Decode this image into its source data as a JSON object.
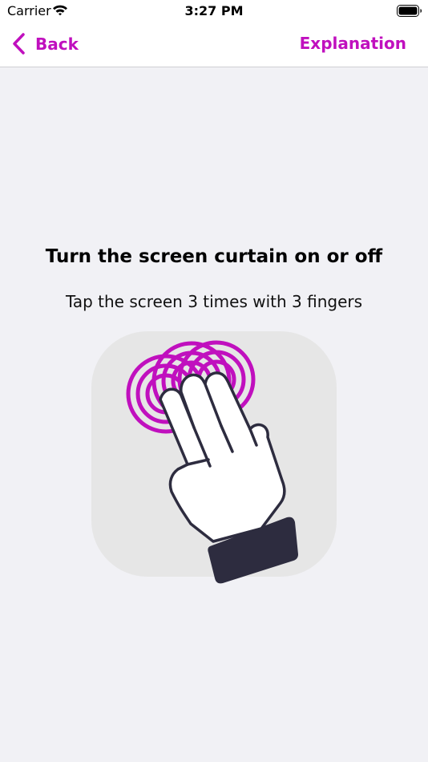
{
  "status_bar": {
    "carrier": "Carrier",
    "time": "3:27 PM",
    "wifi_icon": "wifi-icon",
    "battery_icon": "battery-icon"
  },
  "nav": {
    "back_label": "Back",
    "back_icon": "chevron-left-icon",
    "explanation_label": "Explanation"
  },
  "content": {
    "title": "Turn the screen curtain on or off",
    "instruction": "Tap the screen 3 times with 3 fingers",
    "illustration_icon": "three-finger-triple-tap-icon"
  },
  "colors": {
    "accent": "#c010be",
    "background": "#f1f1f5",
    "hand_outline": "#2d2c3f",
    "sleeve": "#2d2c3f"
  }
}
